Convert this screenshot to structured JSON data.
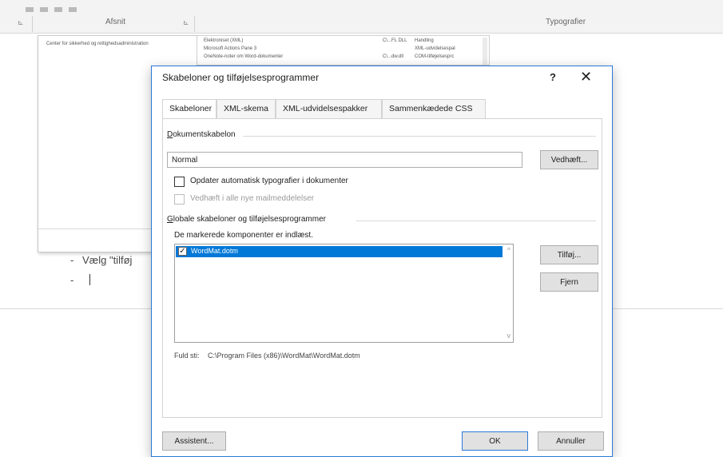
{
  "background": {
    "ribbon": {
      "group_left_label": "Afsnit",
      "group_right_label": "Typografier",
      "launcher_glyph": "⊾"
    },
    "styles_panel": {
      "item": "Center for sikkerhed og rettighedsadministration"
    },
    "list_window": {
      "rows": [
        {
          "name": "Elektroniset (XML)",
          "col2": "C\\...FL DLL",
          "col3": "Handling"
        },
        {
          "name": "Microsoft Actions Pane 3",
          "col2": "",
          "col3": "XML-udvidelsespal"
        },
        {
          "name": "OneNote-noter om Word-dokumenter",
          "col2": "C\\...dw.dll",
          "col3": "COM-tilføjelsesprc"
        }
      ]
    },
    "document": {
      "bullet_glyph": "-",
      "line1_text": "Vælg \"tilføj",
      "line2_text": ""
    }
  },
  "dialog": {
    "title": "Skabeloner og tilføjelsesprogrammer",
    "help_glyph": "?",
    "close_glyph": "✕",
    "tabs": [
      {
        "label": "Skabeloner",
        "active": true
      },
      {
        "label": "XML-skema",
        "active": false
      },
      {
        "label": "XML-udvidelsespakker",
        "active": false
      },
      {
        "label": "Sammenkædede CSS",
        "active": false
      }
    ],
    "document_template": {
      "label_accel": "D",
      "label_rest": "okumentskabelon",
      "value": "Normal",
      "attach_button": "Vedhæft...",
      "auto_update_label": "Opdater automatisk typografier i dokumenter",
      "auto_update_checked": false,
      "attach_mail_label": "Vedhæft i alle nye mailmeddelelser",
      "attach_mail_enabled": false
    },
    "global_templates": {
      "label_accel": "G",
      "label_rest": "lobale skabeloner og tilføjelsesprogrammer",
      "loaded_note": "De markerede komponenter er indlæst.",
      "items": [
        {
          "name": "WordMat.dotm",
          "checked": true,
          "selected": true
        }
      ],
      "add_button": "Tilføj...",
      "remove_button": "Fjern",
      "scroll_up_glyph": "^",
      "scroll_down_glyph": "v",
      "full_path_label": "Fuld sti:",
      "full_path_value": "C:\\Program Files (x86)\\WordMat\\WordMat.dotm"
    },
    "footer": {
      "organizer_button": "Assistent...",
      "ok_button": "OK",
      "cancel_button": "Annuller"
    },
    "colors": {
      "accent": "#0078d7",
      "dialog_border": "#2b79d7"
    }
  }
}
